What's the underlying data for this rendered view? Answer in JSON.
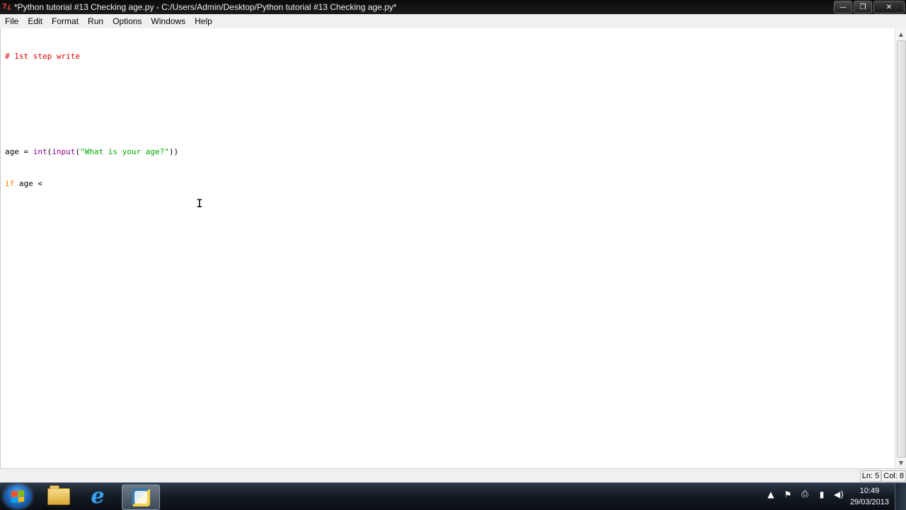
{
  "window": {
    "title": "*Python tutorial #13 Checking age.py - C:/Users/Admin/Desktop/Python tutorial #13 Checking age.py*",
    "app_icon": "idle-icon",
    "app_icon_text": "7¿",
    "controls": {
      "minimize": "—",
      "maximize": "❐",
      "close": "✕"
    }
  },
  "menu": {
    "items": [
      "File",
      "Edit",
      "Format",
      "Run",
      "Options",
      "Windows",
      "Help"
    ]
  },
  "editor": {
    "line1_comment": "# 1st step write",
    "line4": {
      "var": "age = ",
      "int": "int",
      "paren_open": "(",
      "input": "input",
      "paren_open2": "(",
      "string": "\"What is your age?\"",
      "close": "))"
    },
    "line5": {
      "keyword": "if",
      "rest": " age <"
    },
    "cursor_glyph": "I"
  },
  "status": {
    "line": "Ln: 5",
    "col": "Col: 8"
  },
  "taskbar": {
    "apps": [
      "windows-explorer",
      "internet-explorer",
      "python-idle"
    ],
    "ie_glyph": "e",
    "tray_icons": [
      "▲",
      "⚑",
      "⎙",
      "▮",
      "◀)"
    ],
    "time": "10:49",
    "date": "29/03/2013"
  },
  "colors": {
    "comment": "#dd0000",
    "builtin": "#900090",
    "string": "#00aa00",
    "keyword": "#ff7700"
  }
}
